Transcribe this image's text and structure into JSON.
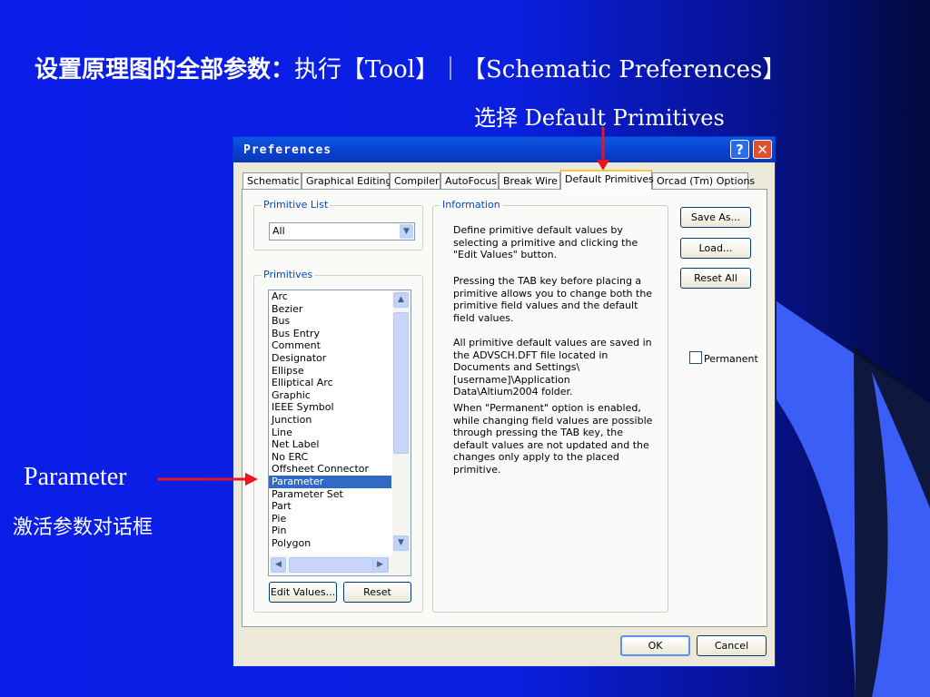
{
  "slide": {
    "title_bold": "设置原理图的全部参数：",
    "title_rest": "执行【Tool】｜【Schematic Preferences】",
    "note_top": "选择 Default Primitives",
    "note_left_1": "Parameter",
    "note_left_2": "激活参数对话框",
    "colors": {
      "background": "#0a1ee8",
      "arrow": "#e8141e"
    }
  },
  "dialog": {
    "title": "Preferences",
    "help_icon": "?",
    "close_icon": "✕",
    "tabs": [
      {
        "label": "Schematic"
      },
      {
        "label": "Graphical Editing"
      },
      {
        "label": "Compiler"
      },
      {
        "label": "AutoFocus"
      },
      {
        "label": "Break Wire"
      },
      {
        "label": "Default Primitives"
      },
      {
        "label": "Orcad (Tm) Options"
      }
    ],
    "primitive_list": {
      "label": "Primitive List",
      "selected": "All"
    },
    "primitives": {
      "label": "Primitives",
      "items": [
        "Arc",
        "Bezier",
        "Bus",
        "Bus Entry",
        "Comment",
        "Designator",
        "Ellipse",
        "Elliptical Arc",
        "Graphic",
        "IEEE Symbol",
        "Junction",
        "Line",
        "Net Label",
        "No ERC",
        "Offsheet Connector",
        "Parameter",
        "Parameter Set",
        "Part",
        "Pie",
        "Pin",
        "Polygon"
      ],
      "selected": "Parameter"
    },
    "edit_values": "Edit Values...",
    "reset": "Reset",
    "information": {
      "label": "Information",
      "p1": "Define primitive default values by selecting a primitive and clicking the \"Edit Values\" button.",
      "p2": "Pressing the TAB key before placing a primitive allows you to change both the primitive field values and the default field values.",
      "p3": "All primitive default values are saved in the ADVSCH.DFT file located in Documents and Settings\\[username]\\Application Data\\Altium2004 folder.",
      "p4": "When \"Permanent\" option is enabled, while changing field values are possible through pressing the TAB key, the default values are not updated and the changes only apply to the placed primitive."
    },
    "save_as": "Save As...",
    "load": "Load...",
    "reset_all": "Reset All",
    "permanent": "Permanent",
    "ok": "OK",
    "cancel": "Cancel"
  }
}
